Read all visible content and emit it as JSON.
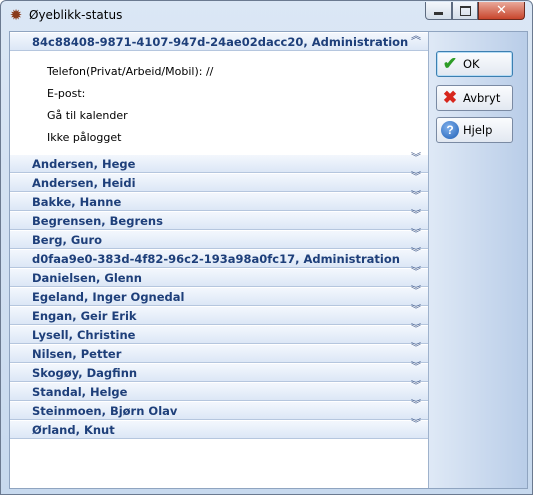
{
  "window": {
    "title": "Øyeblikk-status",
    "app_icon": "gear-emblem-icon",
    "controls": [
      "minimize-icon",
      "maximize-icon",
      "close-icon"
    ]
  },
  "expanded_group": {
    "title": "84c88408-9871-4107-947d-24ae02dacc20, Administration",
    "chevron": "«",
    "details": {
      "phone": "Telefon(Privat/Arbeid/Mobil): //",
      "email": "E-post:",
      "calendar": "Gå til kalender",
      "status": "Ikke pålogget"
    }
  },
  "groups": [
    {
      "title": "Andersen, Hege"
    },
    {
      "title": "Andersen, Heidi"
    },
    {
      "title": "Bakke, Hanne"
    },
    {
      "title": "Begrensen, Begrens"
    },
    {
      "title": "Berg, Guro"
    },
    {
      "title": "d0faa9e0-383d-4f82-96c2-193a98a0fc17, Administration"
    },
    {
      "title": "Danielsen, Glenn"
    },
    {
      "title": "Egeland, Inger Ognedal"
    },
    {
      "title": "Engan, Geir Erik"
    },
    {
      "title": "Lysell, Christine"
    },
    {
      "title": "Nilsen, Petter"
    },
    {
      "title": "Skogøy, Dagfinn"
    },
    {
      "title": "Standal, Helge"
    },
    {
      "title": "Steinmoen, Bjørn Olav"
    },
    {
      "title": "Ørland, Knut"
    }
  ],
  "collapsed_chevron": "»",
  "buttons": {
    "ok": "OK",
    "cancel": "Avbryt",
    "help": "Hjelp"
  },
  "colors": {
    "header_text": "#1e3f7a",
    "accent": "#3c7fb1"
  }
}
